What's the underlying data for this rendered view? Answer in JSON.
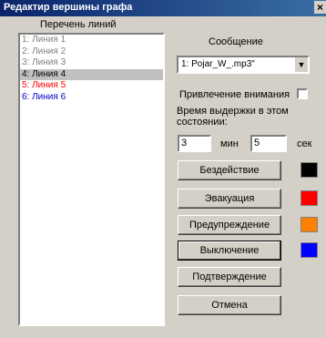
{
  "window": {
    "title": "Редактир вершины графа",
    "close_symbol": "×"
  },
  "lines": {
    "label": "Перечень линий",
    "items": [
      {
        "label": "1: Линия 1",
        "color": "#808080"
      },
      {
        "label": "2: Линия 2",
        "color": "#808080"
      },
      {
        "label": "3: Линия 3",
        "color": "#808080"
      },
      {
        "label": "4: Линия 4",
        "color": "#000000"
      },
      {
        "label": "5: Линия 5",
        "color": "#ff0000"
      },
      {
        "label": "6: Линия 6",
        "color": "#0000cc"
      }
    ]
  },
  "message": {
    "label": "Сообщение",
    "value": "1: Pojar_W_.mp3\""
  },
  "attention": {
    "label": "Привлечение внимания",
    "checked": false
  },
  "hold": {
    "label": "Время выдержки в этом состоянии:",
    "min_value": "3",
    "min_unit": "мин",
    "sec_value": "5",
    "sec_unit": "сек"
  },
  "buttons": {
    "inaction": "Бездействие",
    "evacuation": "Эвакуация",
    "warning": "Предупреждение",
    "off": "Выключение",
    "confirm": "Подтверждение",
    "cancel": "Отмена"
  },
  "swatches": {
    "inaction": "#000000",
    "evacuation": "#ff0000",
    "warning": "#ff8000",
    "off": "#0000ff"
  }
}
